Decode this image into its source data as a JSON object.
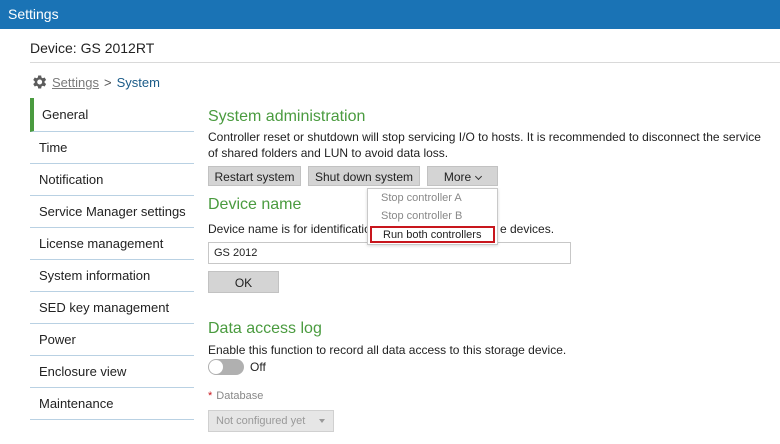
{
  "app": {
    "title": "Settings"
  },
  "device": {
    "title": "Device: GS 2012RT"
  },
  "breadcrumb": {
    "root": "Settings",
    "separator": ">",
    "current": "System"
  },
  "sidebar": {
    "items": [
      {
        "label": "General",
        "active": true
      },
      {
        "label": "Time"
      },
      {
        "label": "Notification"
      },
      {
        "label": "Service Manager settings"
      },
      {
        "label": "License management"
      },
      {
        "label": "System information"
      },
      {
        "label": "SED key management"
      },
      {
        "label": "Power"
      },
      {
        "label": "Enclosure view"
      },
      {
        "label": "Maintenance"
      }
    ]
  },
  "system_admin": {
    "title": "System administration",
    "description": "Controller reset or shutdown will stop servicing I/O to hosts. It is recommended to disconnect the service of shared folders and LUN to avoid data loss.",
    "restart_label": "Restart system",
    "shutdown_label": "Shut down system",
    "more_label": "More",
    "menu": {
      "items": [
        "Stop controller A",
        "Stop controller B",
        "Run both controllers"
      ]
    }
  },
  "device_name": {
    "title": "Device name",
    "description_visible": "Device name is for identification",
    "description_tail": "e devices.",
    "value": "GS 2012",
    "ok_label": "OK"
  },
  "data_access_log": {
    "title": "Data access log",
    "description": "Enable this function to record all data access to this storage device.",
    "toggle_state": "Off",
    "database_required_mark": "*",
    "database_label": "Database",
    "database_value": "Not configured yet"
  },
  "colors": {
    "titlebar": "#1a73b5",
    "accent_green": "#4a9b3f",
    "highlight_red": "#c8161d"
  },
  "icons": {
    "breadcrumb": "gear-icon"
  }
}
